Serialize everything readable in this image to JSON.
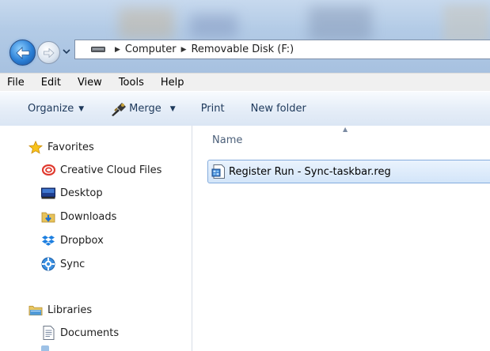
{
  "address": {
    "crumbs": [
      "Computer",
      "Removable Disk (F:)"
    ]
  },
  "menu": {
    "items": [
      "File",
      "Edit",
      "View",
      "Tools",
      "Help"
    ]
  },
  "toolbar": {
    "organize_label": "Organize",
    "merge_label": "Merge",
    "print_label": "Print",
    "new_folder_label": "New folder"
  },
  "navigation": {
    "favorites_label": "Favorites",
    "favorites": [
      {
        "label": "Creative Cloud Files",
        "icon": "creative-cloud-icon"
      },
      {
        "label": "Desktop",
        "icon": "desktop-icon"
      },
      {
        "label": "Downloads",
        "icon": "downloads-folder-icon"
      },
      {
        "label": "Dropbox",
        "icon": "dropbox-icon"
      },
      {
        "label": "Sync",
        "icon": "sync-icon"
      }
    ],
    "libraries_label": "Libraries",
    "libraries": [
      {
        "label": "Documents",
        "icon": "documents-icon"
      }
    ]
  },
  "content": {
    "column_header": "Name",
    "files": [
      {
        "name": "Register Run - Sync-taskbar.reg",
        "icon": "registry-file-icon",
        "selected": true
      }
    ]
  },
  "colors": {
    "accent": "#2a7fd6",
    "selection": "#d3e5f9",
    "toolbar_text": "#1e395b"
  }
}
